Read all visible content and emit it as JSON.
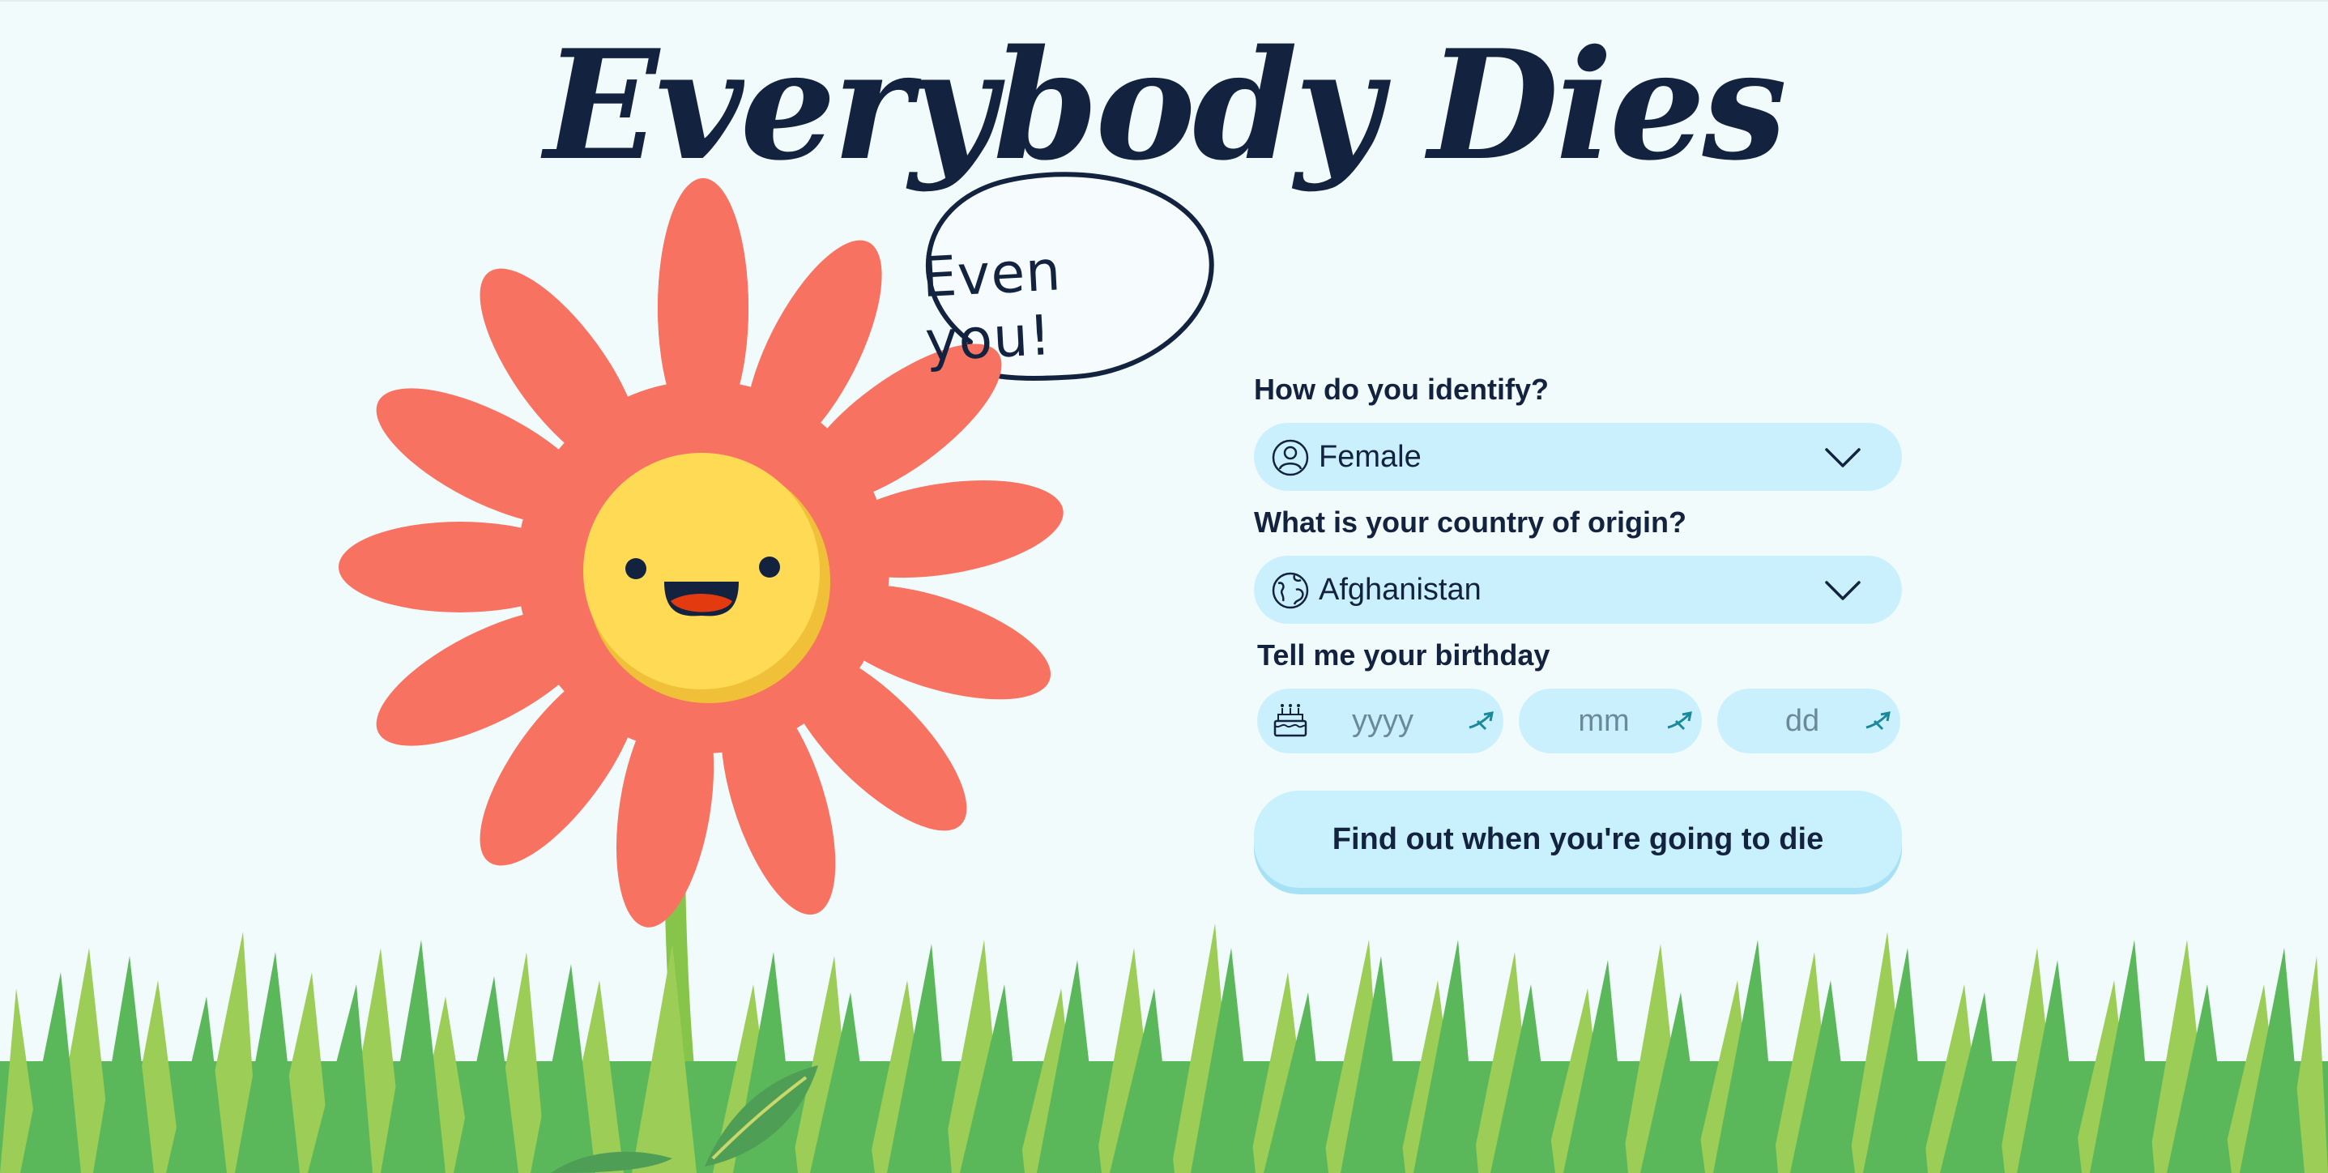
{
  "header": {
    "title": "Everybody Dies"
  },
  "speech_bubble": {
    "text": "Even you!"
  },
  "form": {
    "identify_label": "How do you identify?",
    "gender_value": "Female",
    "gender_icon": "user-icon",
    "country_label": "What is your country of origin?",
    "country_value": "Afghanistan",
    "country_icon": "globe-icon",
    "birthday_label": "Tell me your birthday",
    "birthday_icon": "birthday-cake-icon",
    "year_placeholder": "yyyy",
    "month_placeholder": "mm",
    "day_placeholder": "dd",
    "submit_label": "Find out when you're going to die"
  },
  "colors": {
    "background": "#f1fbfc",
    "title": "#13233f",
    "field_bg": "#cbf0fd",
    "petal": "#f87261",
    "flower_face": "#ffdb55",
    "grass_dark": "#5bb85a",
    "grass_light": "#9bcd57"
  }
}
